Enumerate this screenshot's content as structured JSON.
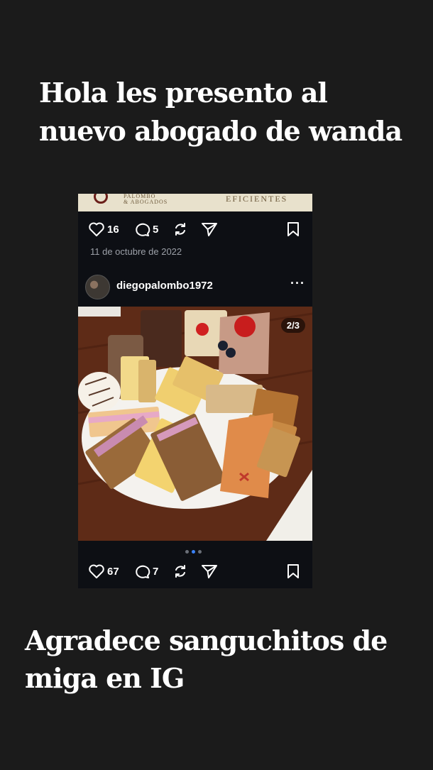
{
  "headline": "Hola les presento al nuevo abogado de wanda",
  "caption": "Agradece sanguchitos de miga en IG",
  "post": {
    "banner": {
      "firm_line1": "PALOMBO",
      "firm_line2": "& ABOGADOS",
      "tagline": "EFICIENTES"
    },
    "top_actions": {
      "likes": "16",
      "comments": "5"
    },
    "date": "11 de octubre de 2022",
    "author": {
      "username": "diegopalombo1972",
      "more_label": "···"
    },
    "photo": {
      "counter": "2/3"
    },
    "carousel": {
      "total": 3,
      "active_index": 1
    },
    "bottom_actions": {
      "likes": "67",
      "comments": "7"
    }
  },
  "icons": [
    "heart-icon",
    "comment-icon",
    "repost-icon",
    "share-icon",
    "bookmark-icon"
  ],
  "colors": {
    "background": "#1b1b1b",
    "post_background": "#0d0f14",
    "accent": "#3b82f6"
  }
}
